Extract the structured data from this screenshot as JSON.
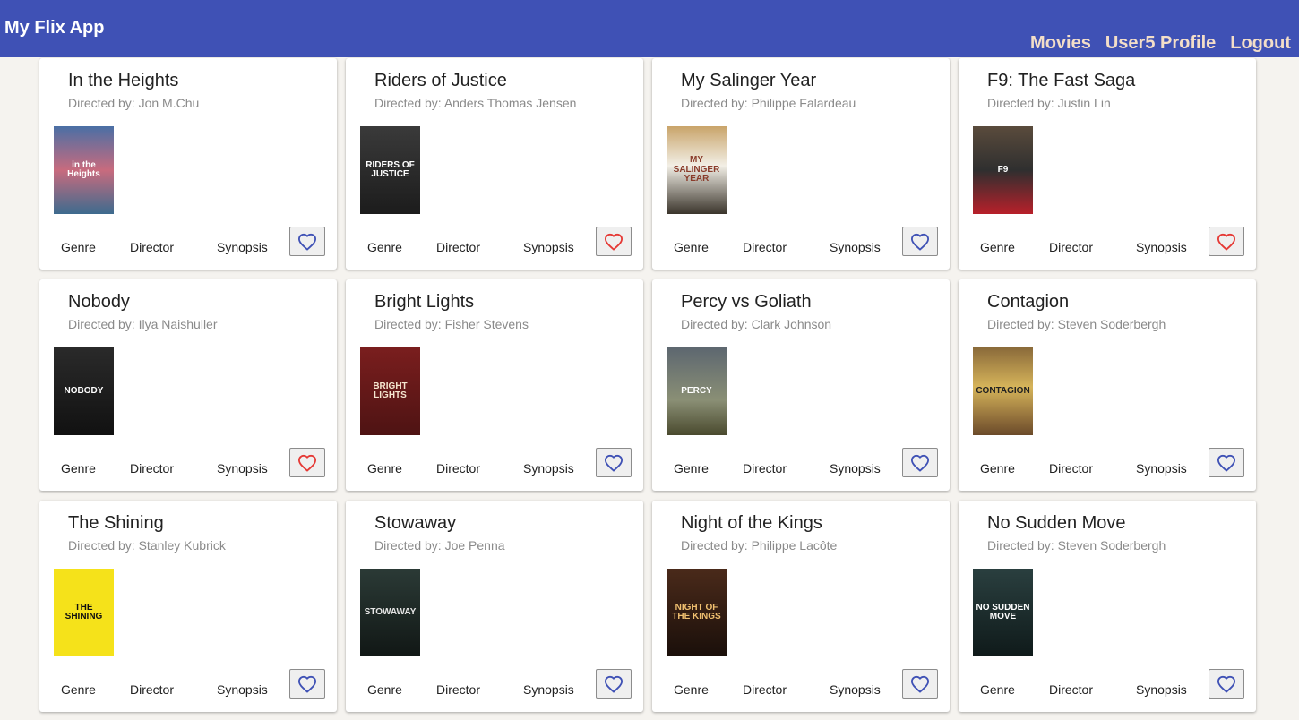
{
  "app": {
    "title": "My Flix App",
    "nav": [
      "Movies",
      "User5 Profile",
      "Logout"
    ]
  },
  "card_actions": {
    "genre": "Genre",
    "director": "Director",
    "synopsis": "Synopsis"
  },
  "colors": {
    "navbar": "#3f51b5",
    "nav_link": "#f3dec8",
    "favorite_on": "#e53935",
    "favorite_off": "#3f51b5"
  },
  "movies": [
    {
      "title": "In the Heights",
      "director": "Directed by: Jon M.Chu",
      "favorite": false,
      "poster_text": "in the Heights",
      "poster_bg": "linear-gradient(#4a6fa5,#c86b7e,#3d6b8e)",
      "poster_fg": "#ffffff"
    },
    {
      "title": "Riders of Justice",
      "director": "Directed by: Anders Thomas Jensen",
      "favorite": true,
      "poster_text": "RIDERS OF JUSTICE",
      "poster_bg": "linear-gradient(#3a3a3a,#1c1c1c)",
      "poster_fg": "#ffffff"
    },
    {
      "title": "My Salinger Year",
      "director": "Directed by: Philippe Falardeau",
      "favorite": false,
      "poster_text": "MY SALINGER YEAR",
      "poster_bg": "linear-gradient(#c9a46a,#f2efe6 45%,#3a342b)",
      "poster_fg": "#8a3b2a"
    },
    {
      "title": "F9: The Fast Saga",
      "director": "Directed by: Justin Lin",
      "favorite": true,
      "poster_text": "F9",
      "poster_bg": "linear-gradient(#5a4b3c,#2f2f2f,#b8202a)",
      "poster_fg": "#ffffff"
    },
    {
      "title": "Nobody",
      "director": "Directed by: Ilya Naishuller",
      "favorite": true,
      "poster_text": "NOBODY",
      "poster_bg": "linear-gradient(#2a2a2a,#111111)",
      "poster_fg": "#ffffff"
    },
    {
      "title": "Bright Lights",
      "director": "Directed by: Fisher Stevens",
      "favorite": false,
      "poster_text": "BRIGHT LIGHTS",
      "poster_bg": "linear-gradient(#7a1e1e,#4e1313)",
      "poster_fg": "#f5e6d0"
    },
    {
      "title": "Percy vs Goliath",
      "director": "Directed by: Clark Johnson",
      "favorite": false,
      "poster_text": "PERCY",
      "poster_bg": "linear-gradient(#5d6770,#8a8f75 60%,#4a4a2e)",
      "poster_fg": "#ffffff"
    },
    {
      "title": "Contagion",
      "director": "Directed by: Steven Soderbergh",
      "favorite": false,
      "poster_text": "CONTAGION",
      "poster_bg": "linear-gradient(#8a6a3a,#d6b45a 45%,#6b4a2a)",
      "poster_fg": "#222222"
    },
    {
      "title": "The Shining",
      "director": "Directed by: Stanley Kubrick",
      "favorite": false,
      "poster_text": "THE SHINING",
      "poster_bg": "linear-gradient(#f5e21a,#f5e21a)",
      "poster_fg": "#111111"
    },
    {
      "title": "Stowaway",
      "director": "Directed by: Joe Penna",
      "favorite": false,
      "poster_text": "STOWAWAY",
      "poster_bg": "linear-gradient(#2b3a36,#111715)",
      "poster_fg": "#e6e6e6"
    },
    {
      "title": "Night of the Kings",
      "director": "Directed by: Philippe Lacôte",
      "favorite": false,
      "poster_text": "NIGHT OF THE KINGS",
      "poster_bg": "linear-gradient(#4a2a1a,#1a0f0a)",
      "poster_fg": "#f0c070"
    },
    {
      "title": "No Sudden Move",
      "director": "Directed by: Steven Soderbergh",
      "favorite": false,
      "poster_text": "NO SUDDEN MOVE",
      "poster_bg": "linear-gradient(#2a3f3f,#0f1a1a)",
      "poster_fg": "#ffffff"
    }
  ]
}
